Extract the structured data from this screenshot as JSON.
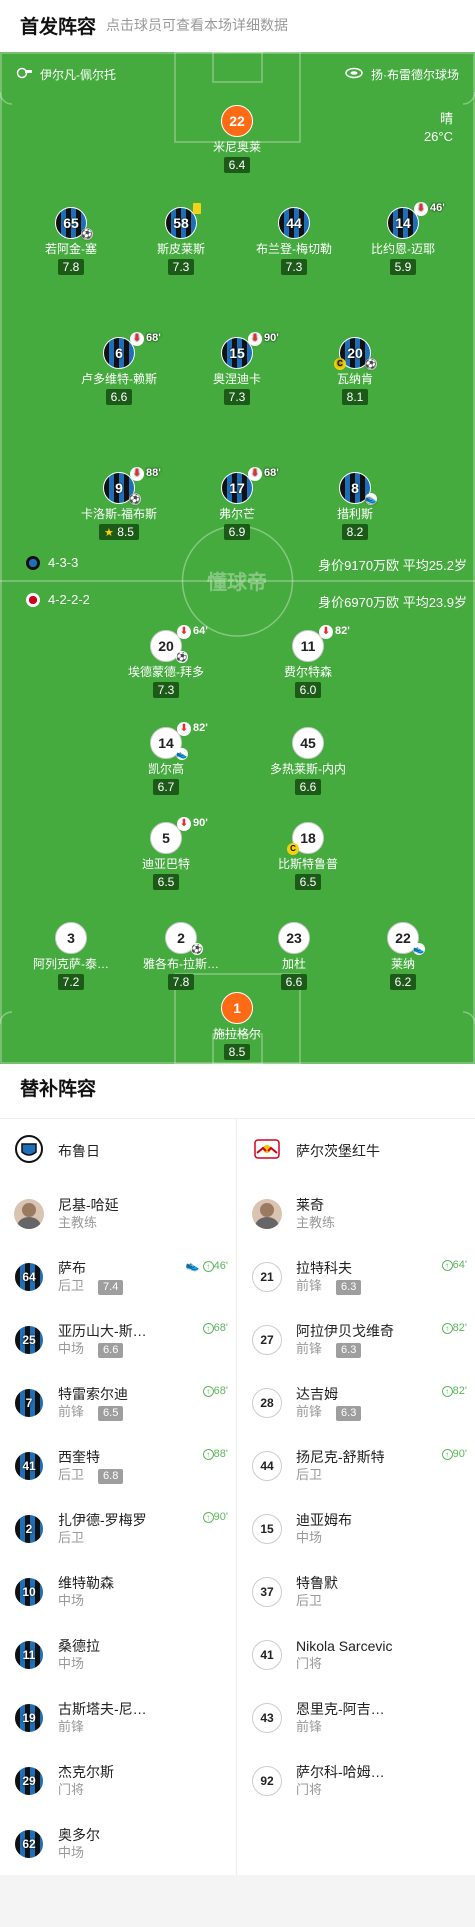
{
  "header": {
    "title": "首发阵容",
    "subtitle": "点击球员可查看本场详细数据"
  },
  "venue": {
    "referee": "伊尔凡-佩尔托",
    "stadium": "扬·布雷德尔球场"
  },
  "weather": {
    "condition": "晴",
    "temperature": "26°C"
  },
  "watermark": "懂球帝",
  "colors": {
    "pitch": "#45ab3e",
    "rating_bg": "#1c5a18",
    "home_stripe_dark": "#111111",
    "home_stripe_blue": "#1f6fb8",
    "gk_orange": "#ff6a14",
    "sub_in_green": "#5cb85c"
  },
  "home": {
    "name": "布鲁日",
    "formation": "4-3-3",
    "value": "身价9170万欧",
    "avg_age": "平均25.2岁",
    "gk": {
      "number": "22",
      "name": "米尼奥莱",
      "rating": "6.4"
    },
    "defenders": [
      {
        "number": "65",
        "name": "若阿金-塞",
        "rating": "7.8"
      },
      {
        "number": "58",
        "name": "斯皮莱斯",
        "rating": "7.3"
      },
      {
        "number": "44",
        "name": "布兰登-梅切勒",
        "rating": "7.3"
      },
      {
        "number": "14",
        "name": "比约恩-迈耶",
        "rating": "5.9",
        "sub_min": "46'"
      }
    ],
    "midfielders": [
      {
        "number": "6",
        "name": "卢多维特-赖斯",
        "rating": "6.6",
        "sub_min": "68'"
      },
      {
        "number": "15",
        "name": "奥涅迪卡",
        "rating": "7.3",
        "sub_min": "90'"
      },
      {
        "number": "20",
        "name": "瓦纳肯",
        "rating": "8.1"
      }
    ],
    "forwards": [
      {
        "number": "9",
        "name": "卡洛斯-福布斯",
        "rating": "8.5",
        "sub_min": "88'"
      },
      {
        "number": "17",
        "name": "弗尔芒",
        "rating": "6.9",
        "sub_min": "68'"
      },
      {
        "number": "8",
        "name": "措利斯",
        "rating": "8.2"
      }
    ]
  },
  "away": {
    "name": "萨尔茨堡红牛",
    "formation": "4-2-2-2",
    "value": "身价6970万欧",
    "avg_age": "平均23.9岁",
    "forwards": [
      {
        "number": "20",
        "name": "埃德蒙德-拜多",
        "rating": "7.3",
        "sub_min": "64'"
      },
      {
        "number": "11",
        "name": "费尔特森",
        "rating": "6.0",
        "sub_min": "82'"
      }
    ],
    "att_mid": [
      {
        "number": "14",
        "name": "凯尔高",
        "rating": "6.7",
        "sub_min": "82'"
      },
      {
        "number": "45",
        "name": "多热莱斯-内内",
        "rating": "6.6"
      }
    ],
    "def_mid": [
      {
        "number": "5",
        "name": "迪亚巴特",
        "rating": "6.5",
        "sub_min": "90'"
      },
      {
        "number": "18",
        "name": "比斯特鲁普",
        "rating": "6.5"
      }
    ],
    "defenders": [
      {
        "number": "3",
        "name": "阿列克萨-泰…",
        "rating": "7.2"
      },
      {
        "number": "2",
        "name": "雅各布-拉斯…",
        "rating": "7.8"
      },
      {
        "number": "23",
        "name": "加杜",
        "rating": "6.6"
      },
      {
        "number": "22",
        "name": "莱纳",
        "rating": "6.2"
      }
    ],
    "gk": {
      "number": "1",
      "name": "施拉格尔",
      "rating": "8.5"
    }
  },
  "subs_section": {
    "title": "替补阵容",
    "home_team": "布鲁日",
    "away_team": "萨尔茨堡红牛",
    "home_coach": {
      "name": "尼基-哈延",
      "role": "主教练"
    },
    "away_coach": {
      "name": "莱奇",
      "role": "主教练"
    },
    "home_subs": [
      {
        "number": "64",
        "name": "萨布",
        "pos": "后卫",
        "rating": "7.4",
        "in": "46'"
      },
      {
        "number": "25",
        "name": "亚历山大-斯…",
        "pos": "中场",
        "rating": "6.6",
        "in": "68'"
      },
      {
        "number": "7",
        "name": "特雷索尔迪",
        "pos": "前锋",
        "rating": "6.5",
        "in": "68'"
      },
      {
        "number": "41",
        "name": "西奎特",
        "pos": "后卫",
        "rating": "6.8",
        "in": "88'"
      },
      {
        "number": "2",
        "name": "扎伊德-罗梅罗",
        "pos": "后卫",
        "rating": "",
        "in": "90'"
      },
      {
        "number": "10",
        "name": "维特勒森",
        "pos": "中场",
        "rating": "",
        "in": ""
      },
      {
        "number": "11",
        "name": "桑德拉",
        "pos": "中场",
        "rating": "",
        "in": ""
      },
      {
        "number": "19",
        "name": "古斯塔夫-尼…",
        "pos": "前锋",
        "rating": "",
        "in": ""
      },
      {
        "number": "29",
        "name": "杰克尔斯",
        "pos": "门将",
        "rating": "",
        "in": ""
      },
      {
        "number": "62",
        "name": "奥多尔",
        "pos": "中场",
        "rating": "",
        "in": ""
      }
    ],
    "away_subs": [
      {
        "number": "21",
        "name": "拉特科夫",
        "pos": "前锋",
        "rating": "6.3",
        "in": "64'"
      },
      {
        "number": "27",
        "name": "阿拉伊贝戈维奇",
        "pos": "前锋",
        "rating": "6.3",
        "in": "82'"
      },
      {
        "number": "28",
        "name": "达吉姆",
        "pos": "前锋",
        "rating": "6.3",
        "in": "82'"
      },
      {
        "number": "44",
        "name": "扬尼克-舒斯特",
        "pos": "后卫",
        "rating": "",
        "in": "90'"
      },
      {
        "number": "15",
        "name": "迪亚姆布",
        "pos": "中场",
        "rating": "",
        "in": ""
      },
      {
        "number": "37",
        "name": "特鲁默",
        "pos": "后卫",
        "rating": "",
        "in": ""
      },
      {
        "number": "41",
        "name": "Nikola Sarcevic",
        "pos": "门将",
        "rating": "",
        "in": ""
      },
      {
        "number": "43",
        "name": "恩里克-阿吉…",
        "pos": "前锋",
        "rating": "",
        "in": ""
      },
      {
        "number": "92",
        "name": "萨尔科-哈姆…",
        "pos": "门将",
        "rating": "",
        "in": ""
      }
    ]
  }
}
